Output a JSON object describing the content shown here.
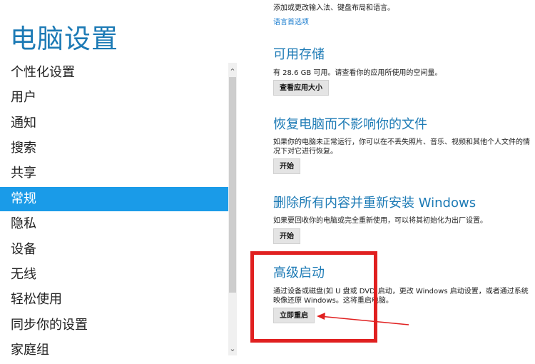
{
  "sidebar": {
    "title": "电脑设置",
    "items": [
      {
        "label": "个性化设置"
      },
      {
        "label": "用户"
      },
      {
        "label": "通知"
      },
      {
        "label": "搜索"
      },
      {
        "label": "共享"
      },
      {
        "label": "常规",
        "active": true
      },
      {
        "label": "隐私"
      },
      {
        "label": "设备"
      },
      {
        "label": "无线"
      },
      {
        "label": "轻松使用"
      },
      {
        "label": "同步你的设置"
      },
      {
        "label": "家庭组"
      }
    ],
    "scroll_up_icon": "chevron-up-icon",
    "scroll_down_icon": "chevron-down-icon"
  },
  "main": {
    "language": {
      "description": "添加或更改输入法、键盘布局和语言。",
      "link": "语言首选项"
    },
    "storage": {
      "heading": "可用存储",
      "description": "有 28.6 GB 可用。请查看你的应用所使用的空间量。",
      "button": "查看应用大小"
    },
    "refresh": {
      "heading": "恢复电脑而不影响你的文件",
      "description": "如果你的电脑未正常运行，你可以在不丢失照片、音乐、视频和其他个人文件的情况下对它进行恢复。",
      "button": "开始"
    },
    "reset": {
      "heading": "删除所有内容并重新安装 Windows",
      "description": "如果要回收你的电脑或完全重新使用，可以将其初始化为出厂设置。",
      "button": "开始"
    },
    "advanced": {
      "heading": "高级启动",
      "description": "通过设备或磁盘(如 U 盘或 DVD)启动，更改 Windows 启动设置，或者通过系统映像还原 Windows。这将重启电脑。",
      "button": "立即重启"
    }
  },
  "annotation": {
    "highlight_color": "#e02020"
  }
}
